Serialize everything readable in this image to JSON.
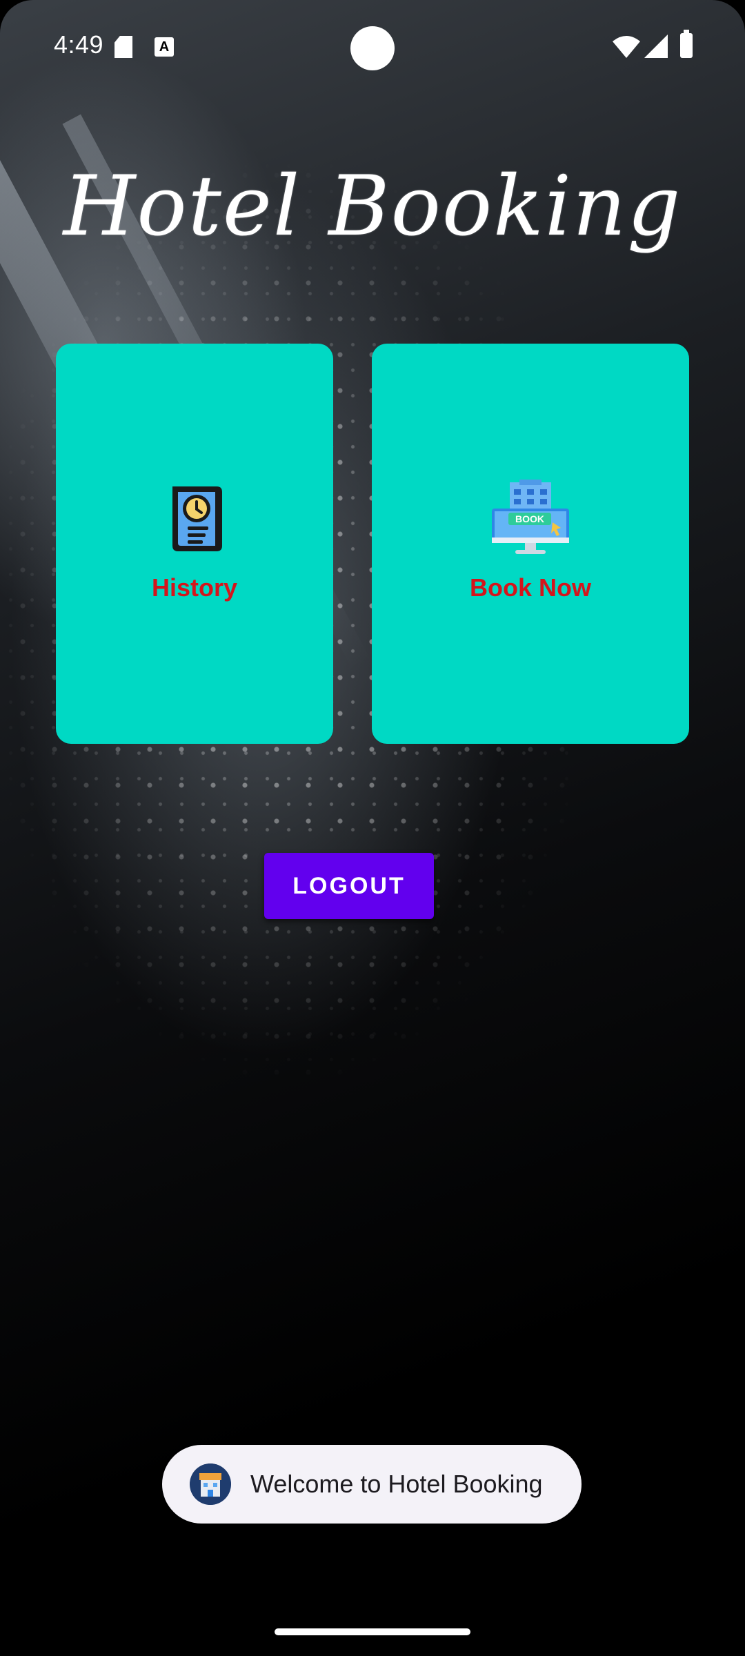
{
  "status_bar": {
    "time": "4:49",
    "notif_a": "A"
  },
  "app": {
    "title": "Hotel Booking"
  },
  "cards": {
    "history": {
      "label": "History",
      "icon": "history-document-clock-icon"
    },
    "book_now": {
      "label": "Book Now",
      "icon": "hotel-book-monitor-icon"
    }
  },
  "logout_button": {
    "label": "LOGOUT"
  },
  "toast": {
    "text": "Welcome to Hotel Booking",
    "icon": "hotel-app-icon"
  },
  "colors": {
    "card_background": "#00d9c4",
    "card_label": "#d4151c",
    "logout_button": "#6200ee",
    "toast_background": "#f4f2f8"
  }
}
